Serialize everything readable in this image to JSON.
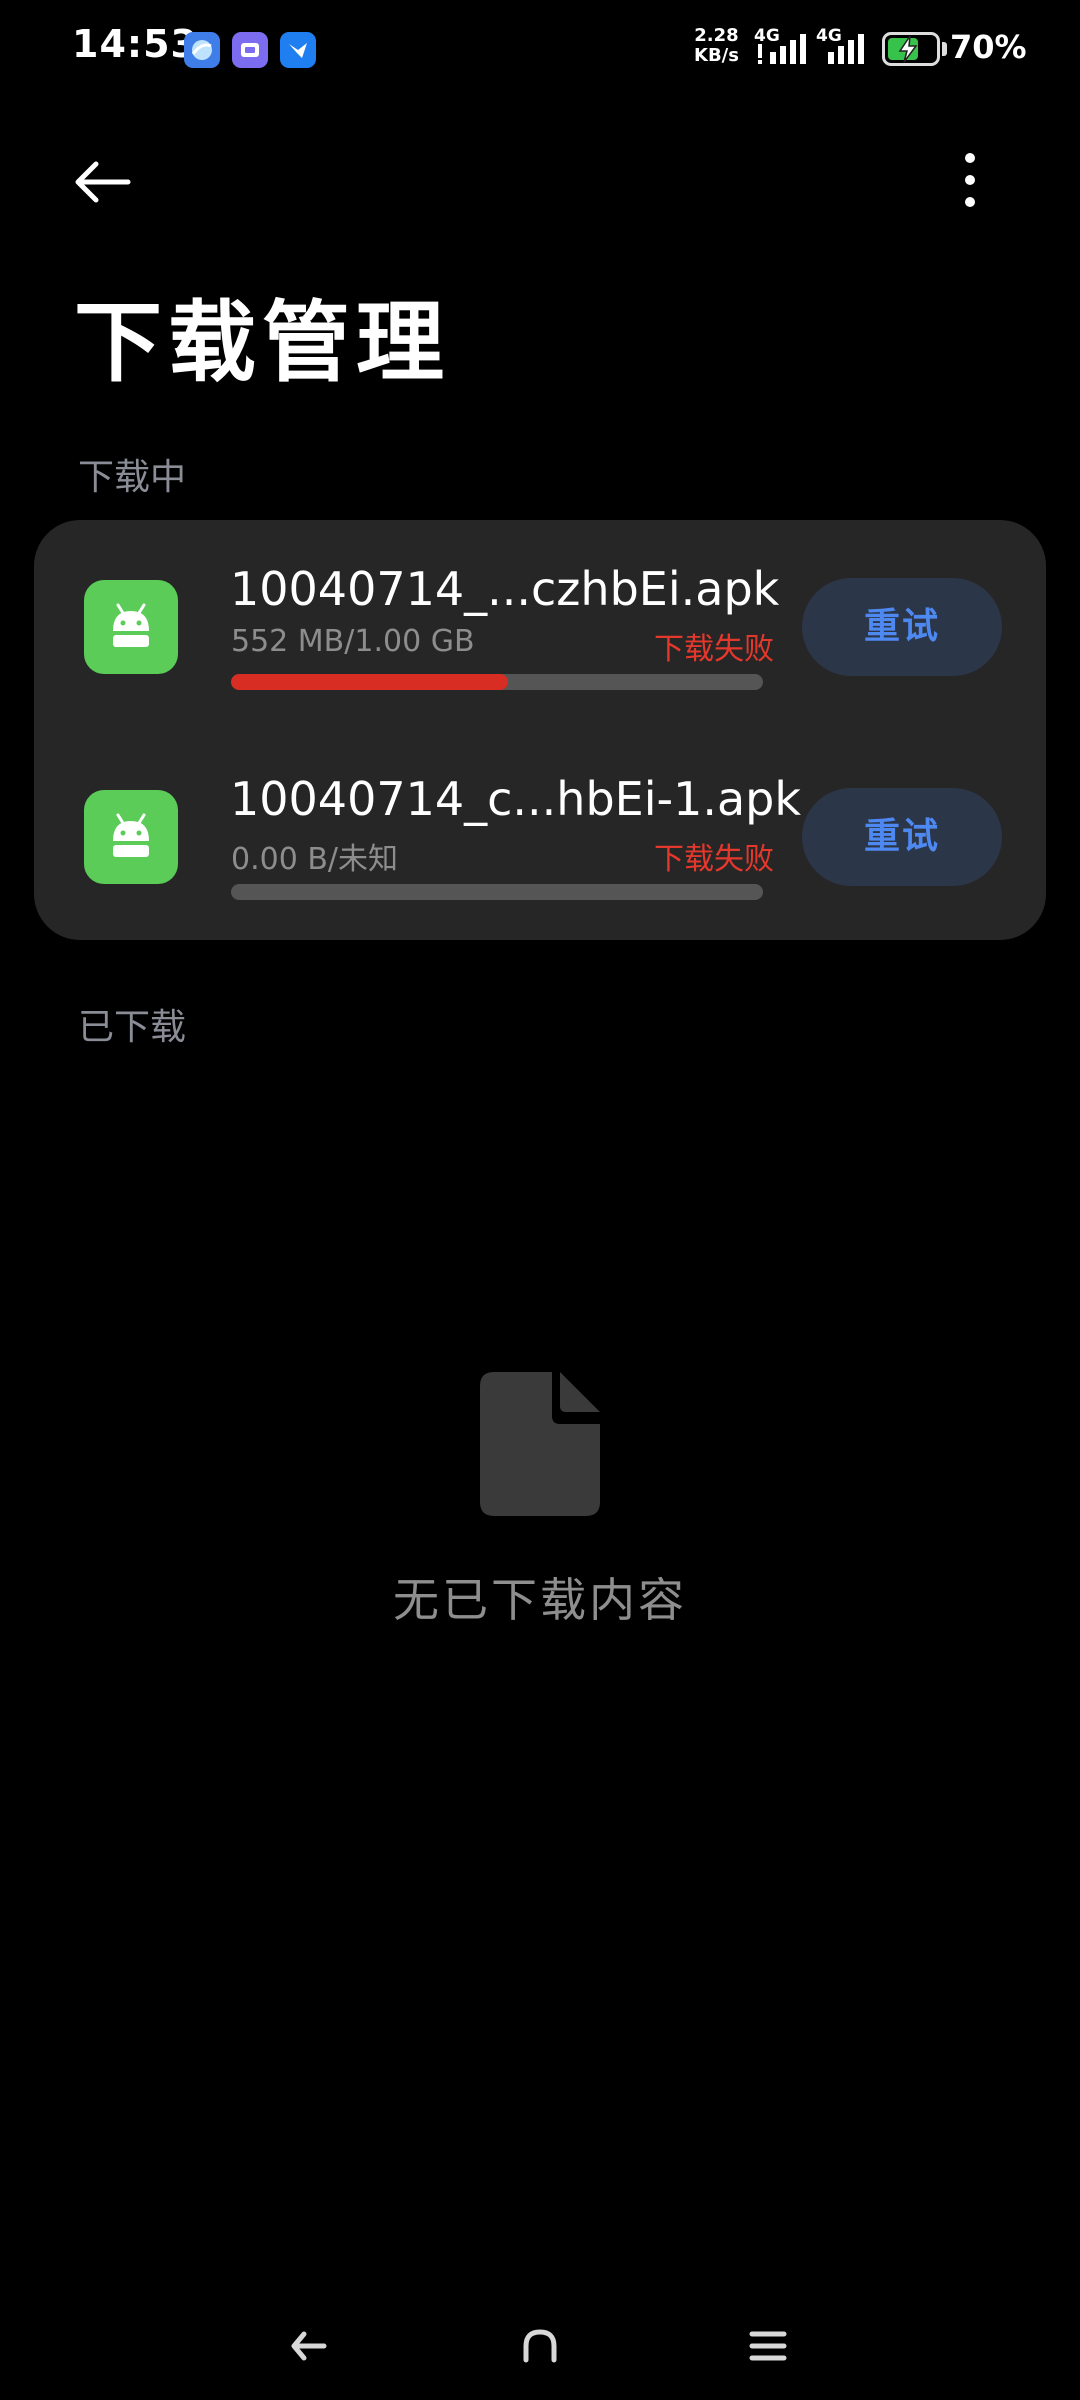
{
  "status_bar": {
    "time": "14:53",
    "app_icons": [
      {
        "name": "browser-app-icon",
        "color": "#3f7de8"
      },
      {
        "name": "game-app-icon",
        "color": "#7b6cf0"
      },
      {
        "name": "bird-app-icon",
        "color": "#1f7ef0"
      }
    ],
    "net_speed_value": "2.28",
    "net_speed_unit": "KB/s",
    "network_1": "4G",
    "network_2": "4G",
    "battery_percent": "70%",
    "battery_level": 0.7
  },
  "header": {
    "title": "下载管理",
    "back_icon": "arrow-left-icon",
    "more_icon": "more-vertical-icon"
  },
  "sections": {
    "downloading_label": "下载中",
    "downloaded_label": "已下载"
  },
  "downloads": [
    {
      "file_name": "10040714_...czhbEi.apk",
      "size": "552 MB/1.00 GB",
      "status": "下载失败",
      "progress": 0.52,
      "action": "重试"
    },
    {
      "file_name": "10040714_c...hbEi-1.apk",
      "size": "0.00 B/未知",
      "status": "下载失败",
      "progress": 0,
      "action": "重试"
    }
  ],
  "empty_state": {
    "icon": "document-icon",
    "text": "无已下载内容"
  },
  "colors": {
    "background": "#000000",
    "card": "#262626",
    "accent": "#4e88f1",
    "error": "#e5382d",
    "app_icon": "#5bcc58"
  },
  "nav_bar": {
    "back_icon": "nav-back-icon",
    "home_icon": "nav-home-icon",
    "recents_icon": "nav-recents-icon"
  }
}
